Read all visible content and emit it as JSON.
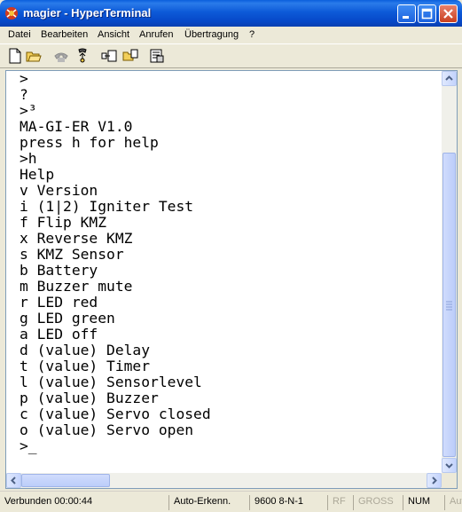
{
  "window": {
    "title": "magier - HyperTerminal"
  },
  "menu": [
    "Datei",
    "Bearbeiten",
    "Ansicht",
    "Anrufen",
    "Übertragung",
    "?"
  ],
  "terminal": {
    "lines": [
      ">",
      "?",
      ">³",
      "MA-GI-ER V1.0",
      "press h for help",
      ">h",
      "Help",
      "v Version",
      "i (1|2) Igniter Test",
      "f Flip KMZ",
      "x Reverse KMZ",
      "s KMZ Sensor",
      "b Battery",
      "m Buzzer mute",
      "r LED red",
      "g LED green",
      "a LED off",
      "d (value) Delay",
      "t (value) Timer",
      "l (value) Sensorlevel",
      "p (value) Buzzer",
      "c (value) Servo closed",
      "o (value) Servo open",
      ">_"
    ]
  },
  "status": {
    "connected": "Verbunden 00:00:44",
    "detect": "Auto-Erkenn.",
    "params": "9600 8-N-1",
    "rf": "RF",
    "caps": "GROSS",
    "num": "NUM",
    "extra": "Auf"
  }
}
